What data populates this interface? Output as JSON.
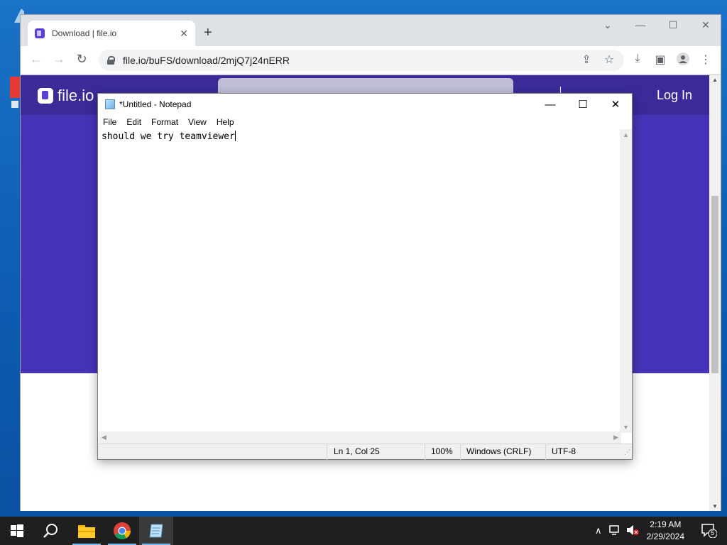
{
  "browser": {
    "tab_title": "Download | file.io",
    "url": "file.io/buFS/download/2mjQ7j24nERR",
    "site": {
      "logo_text": "file.io",
      "login_label": "Log In"
    }
  },
  "notepad": {
    "title": "*Untitled - Notepad",
    "menu": [
      "File",
      "Edit",
      "Format",
      "View",
      "Help"
    ],
    "content": "should we try teamviewer",
    "status": {
      "position": "Ln 1, Col 25",
      "zoom": "100%",
      "line_ending": "Windows (CRLF)",
      "encoding": "UTF-8"
    }
  },
  "taskbar": {
    "time": "2:19 AM",
    "date": "2/29/2024",
    "notification_count": "5"
  }
}
